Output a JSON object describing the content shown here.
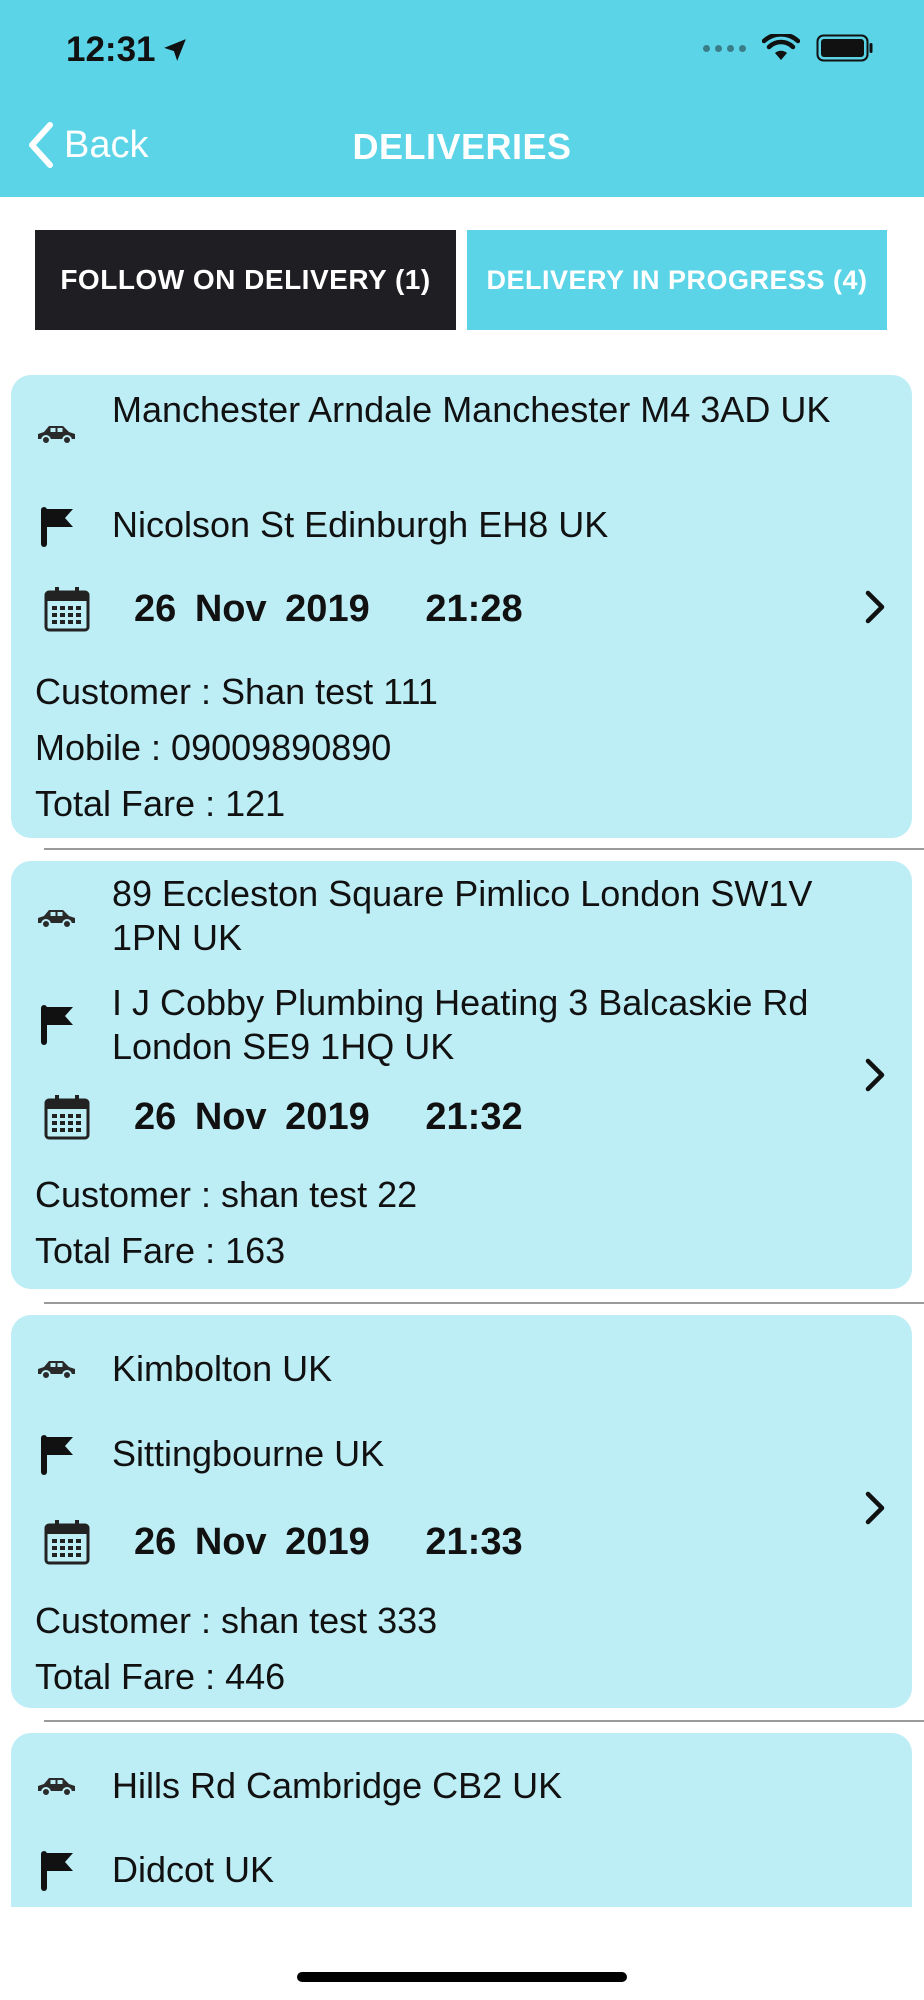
{
  "status_bar": {
    "time": "12:31"
  },
  "nav": {
    "back_label": "Back",
    "title": "DELIVERIES"
  },
  "tabs": [
    {
      "label": "FOLLOW ON DELIVERY (1)"
    },
    {
      "label": "DELIVERY IN PROGRESS (4)"
    }
  ],
  "deliveries": [
    {
      "pickup": "Manchester Arndale  Manchester M4 3AD  UK",
      "dropoff": "Nicolson St  Edinburgh EH8  UK",
      "date": "26 Nov 2019",
      "time": "21:28",
      "customer": "Customer : Shan test 111",
      "mobile": "Mobile : 09009890890",
      "fare": "Total Fare : 121"
    },
    {
      "pickup": "89 Eccleston Square  Pimlico  London SW1V 1PN  UK",
      "dropoff": "I J Cobby Plumbing   Heating  3 Balcaskie Rd  London SE9 1HQ  UK",
      "date": "26 Nov 2019",
      "time": "21:32",
      "customer": "Customer : shan test 22",
      "fare": "Total Fare : 163"
    },
    {
      "pickup": "Kimbolton  UK",
      "dropoff": "Sittingbourne  UK",
      "date": "26 Nov 2019",
      "time": "21:33",
      "customer": "Customer : shan test 333",
      "fare": "Total Fare : 446"
    },
    {
      "pickup": "Hills Rd  Cambridge CB2  UK",
      "dropoff": "Didcot  UK"
    }
  ],
  "icons": {
    "pickup": "car-icon",
    "dropoff": "flag-icon",
    "date": "calendar-icon",
    "open": "chevron-right-icon"
  },
  "colors": {
    "header": "#5ad4e6",
    "card": "#bdedf5",
    "tab_dark": "#1f1f23"
  }
}
